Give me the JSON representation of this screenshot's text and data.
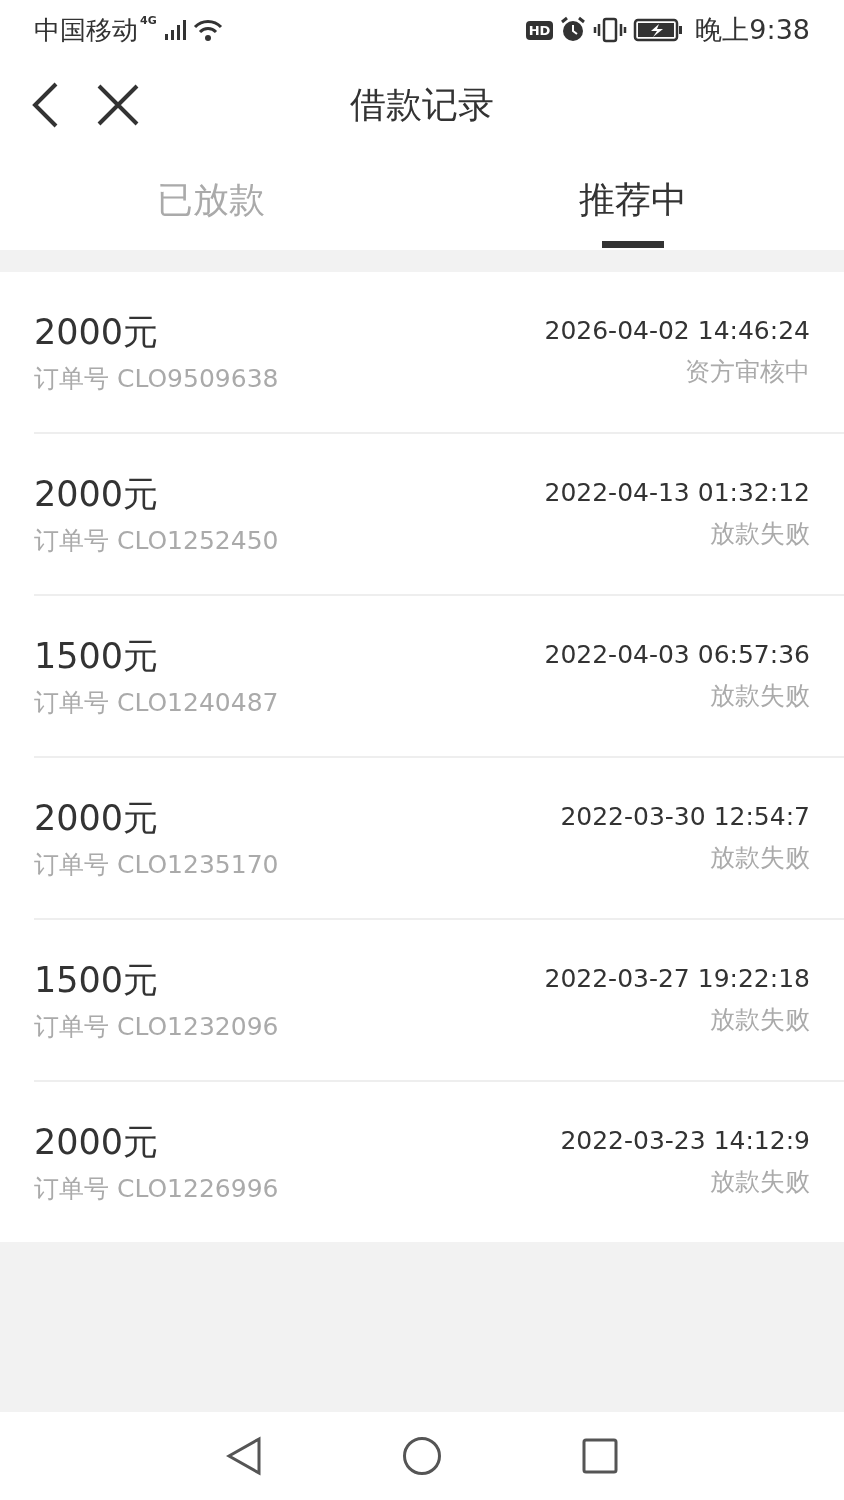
{
  "status_bar": {
    "carrier": "中国移动",
    "network": "4G",
    "badge": "HD",
    "time": "晚上9:38"
  },
  "header": {
    "title": "借款记录"
  },
  "tabs": [
    {
      "label": "已放款",
      "selected": false
    },
    {
      "label": "推荐中",
      "selected": true
    }
  ],
  "records": [
    {
      "amount": "2000元",
      "order": "订单号 CLO9509638",
      "time": "2026-04-02 14:46:24",
      "status": "资方审核中"
    },
    {
      "amount": "2000元",
      "order": "订单号 CLO1252450",
      "time": "2022-04-13 01:32:12",
      "status": "放款失败"
    },
    {
      "amount": "1500元",
      "order": "订单号 CLO1240487",
      "time": "2022-04-03 06:57:36",
      "status": "放款失败"
    },
    {
      "amount": "2000元",
      "order": "订单号 CLO1235170",
      "time": "2022-03-30 12:54:7",
      "status": "放款失败"
    },
    {
      "amount": "1500元",
      "order": "订单号 CLO1232096",
      "time": "2022-03-27 19:22:18",
      "status": "放款失败"
    },
    {
      "amount": "2000元",
      "order": "订单号 CLO1226996",
      "time": "2022-03-23 14:12:9",
      "status": "放款失败"
    }
  ]
}
